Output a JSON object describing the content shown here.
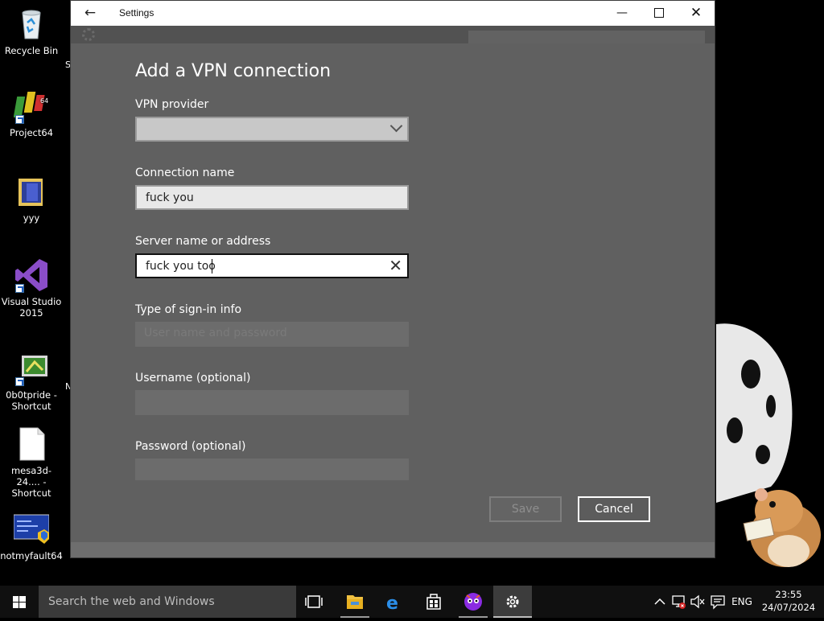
{
  "desktop": {
    "icons": [
      {
        "label": "Recycle Bin"
      },
      {
        "label": "Project64"
      },
      {
        "label": "yyy"
      },
      {
        "label": "Visual Studio 2015"
      },
      {
        "label": "0b0tpride - Shortcut"
      },
      {
        "label": "mesa3d-24.... - Shortcut"
      },
      {
        "label": "notmyfault64"
      }
    ]
  },
  "window": {
    "title": "Settings",
    "back_icon": "back-arrow-icon",
    "controls": {
      "minimize": "minimize-icon",
      "maximize": "maximize-icon",
      "close": "close-icon"
    }
  },
  "dialog": {
    "title": "Add a VPN connection",
    "vpn_provider": {
      "label": "VPN provider",
      "value": ""
    },
    "connection_name": {
      "label": "Connection name",
      "value": "fuck you"
    },
    "server_name": {
      "label": "Server name or address",
      "value": "fuck you too"
    },
    "signin_type": {
      "label": "Type of sign-in info",
      "value": "User name and password"
    },
    "username": {
      "label": "Username (optional)",
      "value": ""
    },
    "password": {
      "label": "Password (optional)",
      "value": ""
    },
    "save_label": "Save",
    "cancel_label": "Cancel"
  },
  "taskbar": {
    "search_placeholder": "Search the web and Windows",
    "apps": [
      "task-view-icon",
      "file-explorer-icon",
      "edge-icon",
      "store-icon",
      "media-app-icon",
      "settings-icon"
    ],
    "language": "ENG",
    "time": "23:55",
    "date": "24/07/2024"
  },
  "colors": {
    "dialog_bg": "#606060",
    "taskbar_bg": "#101010",
    "search_bg": "#3a3a3a"
  }
}
